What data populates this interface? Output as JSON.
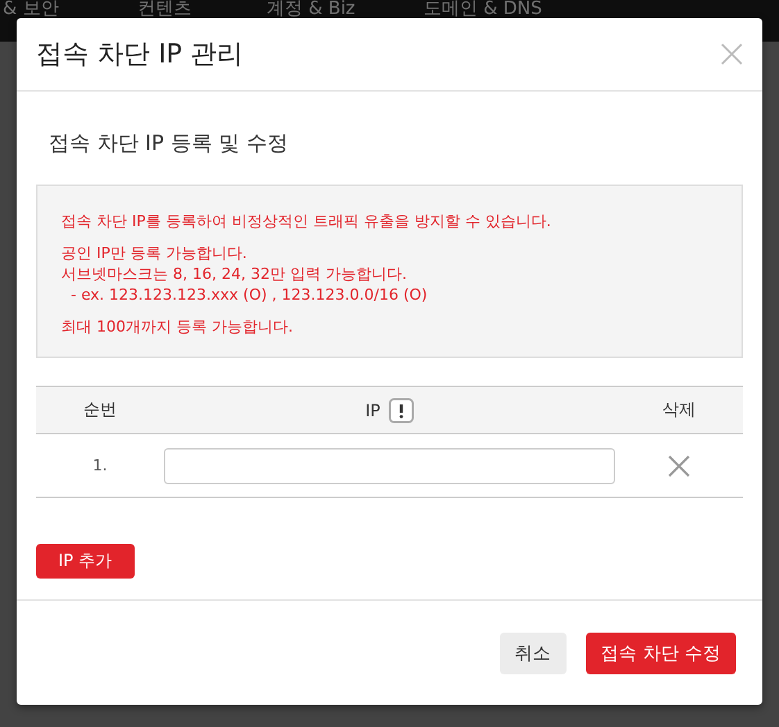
{
  "nav": {
    "items": [
      "& 보안",
      "컨텐츠",
      "계정 & Biz",
      "도메인 & DNS"
    ]
  },
  "dialog": {
    "title": "접속 차단 IP 관리",
    "subtitle": "접속 차단 IP 등록 및 수정",
    "notice": [
      [
        "접속 차단 IP를 등록하여 비정상적인 트래픽 유출을 방지할 수 있습니다."
      ],
      [
        "공인 IP만 등록 가능합니다.",
        "서브넷마스크는 8, 16, 24, 32만 입력 가능합니다.",
        "  - ex. 123.123.123.xxx (O) , 123.123.0.0/16 (O)"
      ],
      [
        "최대 100개까지 등록 가능합니다."
      ]
    ],
    "table": {
      "columns": [
        "순번",
        "IP",
        "삭제"
      ],
      "rows": [
        {
          "number": "1.",
          "value": ""
        }
      ]
    },
    "add_button": "IP 추가",
    "buttons": [
      {
        "label": "취소",
        "kind": "secondary"
      },
      {
        "label": "접속 차단 수정",
        "kind": "primary"
      }
    ]
  }
}
